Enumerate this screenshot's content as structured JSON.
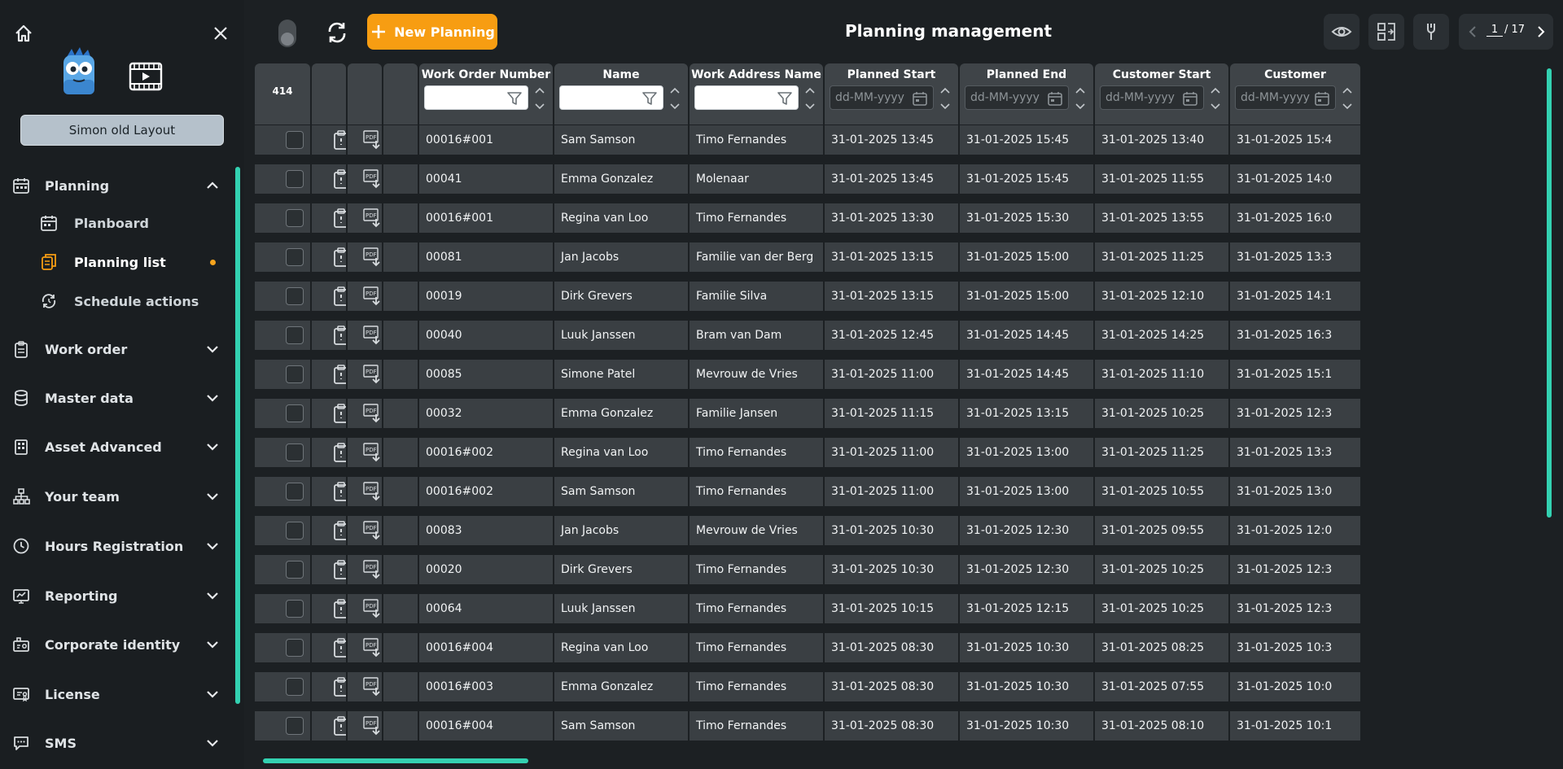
{
  "colors": {
    "accent": "#f79d12",
    "teal": "#33d1b1",
    "dot": "#f7a41d"
  },
  "sidebar": {
    "layout_button": "Simon old Layout",
    "planning": {
      "label": "Planning",
      "icon": "calendar-icon",
      "items": [
        {
          "label": "Planboard",
          "icon": "calendar-icon"
        },
        {
          "label": "Planning list",
          "icon": "copy-icon",
          "active": true
        },
        {
          "label": "Schedule actions",
          "icon": "sync-clock-icon"
        }
      ]
    },
    "sections": [
      {
        "label": "Work order",
        "icon": "clipboard-icon"
      },
      {
        "label": "Master data",
        "icon": "database-icon"
      },
      {
        "label": "Asset Advanced",
        "icon": "building-icon"
      },
      {
        "label": "Your team",
        "icon": "team-icon"
      },
      {
        "label": "Hours Registration",
        "icon": "clock-icon"
      },
      {
        "label": "Reporting",
        "icon": "report-icon"
      },
      {
        "label": "Corporate identity",
        "icon": "identity-icon"
      },
      {
        "label": "License",
        "icon": "license-icon"
      },
      {
        "label": "SMS",
        "icon": "chat-icon"
      }
    ]
  },
  "topbar": {
    "new_button": "New Planning",
    "title": "Planning management",
    "page_current": "1",
    "page_total": "/ 17"
  },
  "grid": {
    "count": "414",
    "columns": {
      "work_order": "Work Order Number",
      "name": "Name",
      "address": "Work Address Name",
      "planned_start": "Planned Start",
      "planned_end": "Planned End",
      "customer_start": "Customer Start",
      "customer_end": "Customer"
    },
    "date_placeholder": "dd-MM-yyyy",
    "rows": [
      {
        "wo": "00016#001",
        "name": "Sam Samson",
        "addr": "Timo Fernandes",
        "ps": "31-01-2025 13:45",
        "pe": "31-01-2025 15:45",
        "cs": "31-01-2025 13:40",
        "ce": "31-01-2025 15:4"
      },
      {
        "wo": "00041",
        "name": "Emma Gonzalez",
        "addr": "Molenaar",
        "ps": "31-01-2025 13:45",
        "pe": "31-01-2025 15:45",
        "cs": "31-01-2025 11:55",
        "ce": "31-01-2025 14:0"
      },
      {
        "wo": "00016#001",
        "name": "Regina van Loo",
        "addr": "Timo Fernandes",
        "ps": "31-01-2025 13:30",
        "pe": "31-01-2025 15:30",
        "cs": "31-01-2025 13:55",
        "ce": "31-01-2025 16:0"
      },
      {
        "wo": "00081",
        "name": "Jan Jacobs",
        "addr": "Familie van der Berg",
        "ps": "31-01-2025 13:15",
        "pe": "31-01-2025 15:00",
        "cs": "31-01-2025 11:25",
        "ce": "31-01-2025 13:3"
      },
      {
        "wo": "00019",
        "name": "Dirk Grevers",
        "addr": "Familie Silva",
        "ps": "31-01-2025 13:15",
        "pe": "31-01-2025 15:00",
        "cs": "31-01-2025 12:10",
        "ce": "31-01-2025 14:1"
      },
      {
        "wo": "00040",
        "name": "Luuk Janssen",
        "addr": "Bram van Dam",
        "ps": "31-01-2025 12:45",
        "pe": "31-01-2025 14:45",
        "cs": "31-01-2025 14:25",
        "ce": "31-01-2025 16:3"
      },
      {
        "wo": "00085",
        "name": "Simone Patel",
        "addr": "Mevrouw de Vries",
        "ps": "31-01-2025 11:00",
        "pe": "31-01-2025 14:45",
        "cs": "31-01-2025 11:10",
        "ce": "31-01-2025 15:1"
      },
      {
        "wo": "00032",
        "name": "Emma Gonzalez",
        "addr": "Familie Jansen",
        "ps": "31-01-2025 11:15",
        "pe": "31-01-2025 13:15",
        "cs": "31-01-2025 10:25",
        "ce": "31-01-2025 12:3"
      },
      {
        "wo": "00016#002",
        "name": "Regina van Loo",
        "addr": "Timo Fernandes",
        "ps": "31-01-2025 11:00",
        "pe": "31-01-2025 13:00",
        "cs": "31-01-2025 11:25",
        "ce": "31-01-2025 13:3"
      },
      {
        "wo": "00016#002",
        "name": "Sam Samson",
        "addr": "Timo Fernandes",
        "ps": "31-01-2025 11:00",
        "pe": "31-01-2025 13:00",
        "cs": "31-01-2025 10:55",
        "ce": "31-01-2025 13:0"
      },
      {
        "wo": "00083",
        "name": "Jan Jacobs",
        "addr": "Mevrouw de Vries",
        "ps": "31-01-2025 10:30",
        "pe": "31-01-2025 12:30",
        "cs": "31-01-2025 09:55",
        "ce": "31-01-2025 12:0"
      },
      {
        "wo": "00020",
        "name": "Dirk Grevers",
        "addr": "Timo Fernandes",
        "ps": "31-01-2025 10:30",
        "pe": "31-01-2025 12:30",
        "cs": "31-01-2025 10:25",
        "ce": "31-01-2025 12:3"
      },
      {
        "wo": "00064",
        "name": "Luuk Janssen",
        "addr": "Timo Fernandes",
        "ps": "31-01-2025 10:15",
        "pe": "31-01-2025 12:15",
        "cs": "31-01-2025 10:25",
        "ce": "31-01-2025 12:3"
      },
      {
        "wo": "00016#004",
        "name": "Regina van Loo",
        "addr": "Timo Fernandes",
        "ps": "31-01-2025 08:30",
        "pe": "31-01-2025 10:30",
        "cs": "31-01-2025 08:25",
        "ce": "31-01-2025 10:3"
      },
      {
        "wo": "00016#003",
        "name": "Emma Gonzalez",
        "addr": "Timo Fernandes",
        "ps": "31-01-2025 08:30",
        "pe": "31-01-2025 10:30",
        "cs": "31-01-2025 07:55",
        "ce": "31-01-2025 10:0"
      },
      {
        "wo": "00016#004",
        "name": "Sam Samson",
        "addr": "Timo Fernandes",
        "ps": "31-01-2025 08:30",
        "pe": "31-01-2025 10:30",
        "cs": "31-01-2025 08:10",
        "ce": "31-01-2025 10:1"
      }
    ]
  }
}
